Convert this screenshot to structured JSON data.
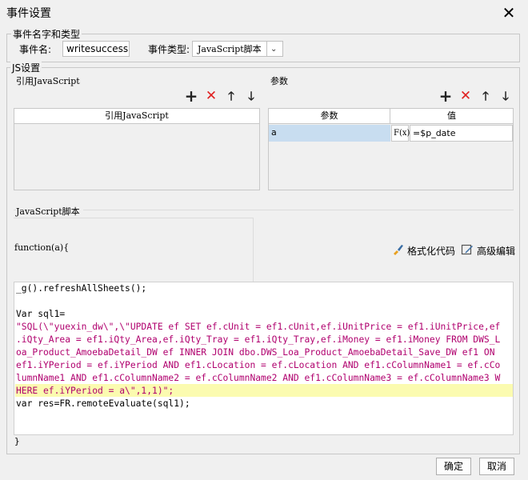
{
  "window": {
    "title": "事件设置"
  },
  "event_name_group": {
    "legend": "事件名字和类型",
    "name_label": "事件名:",
    "name_value": "writesuccess",
    "type_label": "事件类型:",
    "type_value": "JavaScript脚本"
  },
  "js_settings": {
    "legend": "JS设置",
    "ref_js": {
      "title": "引用JavaScript",
      "column": "引用JavaScript",
      "rows": []
    },
    "params": {
      "title": "参数",
      "columns": [
        "参数",
        "值"
      ],
      "rows": [
        {
          "name": "a",
          "formula_icon": "F(x)",
          "value": "=$p_date"
        }
      ]
    },
    "script": {
      "title": "JavaScript脚本",
      "header_line": "function(a){",
      "format_label": "格式化代码",
      "advanced_label": "高级编辑",
      "code_lines": [
        "_g().refreshAllSheets();",
        "",
        "Var sql1=",
        "\"SQL(\\\"yuexin_dw\\\",\\\"UPDATE ef SET ef.cUnit = ef1.cUnit,ef.iUnitPrice = ef1.iUnitPrice,ef",
        ".iQty_Area = ef1.iQty_Area,ef.iQty_Tray = ef1.iQty_Tray,ef.iMoney = ef1.iMoney FROM DWS_L",
        "oa_Product_AmoebaDetail_DW ef INNER JOIN dbo.DWS_Loa_Product_AmoebaDetail_Save_DW ef1 ON",
        "ef1.iYPeriod = ef.iYPeriod AND ef1.cLocation = ef.cLocation AND ef1.cColumnName1 = ef.cCo",
        "lumnName1 AND ef1.cColumnName2 = ef.cColumnName2 AND ef1.cColumnName3 = ef.cColumnName3 W",
        "HERE ef.iYPeriod = a\\\",1,1)\";",
        "var res=FR.remoteEvaluate(sql1);"
      ],
      "footer_line": "}"
    }
  },
  "footer": {
    "ok_label": "确定",
    "cancel_label": "取消"
  },
  "colors": {
    "accent_red": "#e02020",
    "selection": "#c8ddf0",
    "highlight_line": "#fbfbb0",
    "string": "#b0006e",
    "keyword": "#0000c8"
  },
  "icons": {
    "close": "close-icon",
    "add": "plus-icon",
    "delete": "delete-x-icon",
    "up": "arrow-up-icon",
    "down": "arrow-down-icon",
    "format": "brush-icon",
    "advanced": "edit-icon"
  }
}
